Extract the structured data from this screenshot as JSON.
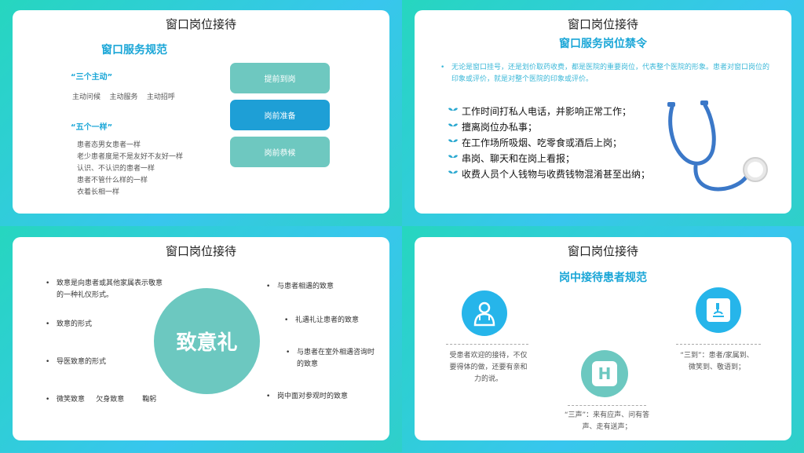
{
  "slide1": {
    "title": "窗口岗位接待",
    "subtitle": "窗口服务规范",
    "heading1": "“三个主动”",
    "line1": "主动问候    主动服务    主动招呼",
    "heading2": "“五个一样”",
    "five_lines": [
      "患者态男女患者一样",
      "老少患者度是不是友好不友好一样",
      "认识、不认识的患者一样",
      "患者不管什么样的一样",
      "衣着长相一样"
    ],
    "buttons": [
      "提前到岗",
      "岗前准备",
      "岗前恭候"
    ]
  },
  "slide2": {
    "title": "窗口岗位接待",
    "subtitle": "窗口服务岗位禁令",
    "intro": "无论是窗口挂号，还是划价取药收费，都是医院的重要岗位，代表整个医院的形象。患者对窗口岗位的印象或评价，就是对整个医院的印象或评价。",
    "rules": [
      "工作时间打私人电话，并影响正常工作；",
      "擅离岗位办私事；",
      "在工作场所吸烟、吃零食或酒后上岗；",
      "串岗、聊天和在岗上看报；",
      "收费人员个人钱物与收费钱物混淆甚至出纳；"
    ]
  },
  "slide3": {
    "title": "窗口岗位接待",
    "center": "致意礼",
    "left": [
      "致意是向患者或其他家属表示敬意的一种礼仪形式。",
      "致意的形式",
      "导医致意的形式",
      "微笑致意     欠身致意        鞠躬"
    ],
    "right": [
      "与患者相遇的致意",
      "礼遇礼让患者的致意",
      "与患者在室外相遇咨询时的致意",
      "岗中面对参观时的致意"
    ]
  },
  "slide4": {
    "title": "窗口岗位接待",
    "subtitle": "岗中接待患者规范",
    "left_text": "受患者欢迎的接待，不仅要得体的做，还要有亲和力的说。",
    "mid_text": "“三声”：来有应声、问有答声、走有送声；",
    "right_text": "“三到”：患者/家属到、微笑到、敬语到；",
    "h_letter": "H"
  },
  "colors": {
    "accent": "#1aa6d7",
    "teal_button": "#6ec8c0",
    "blue_button": "#1e9fd6",
    "circle": "#6cc8c0"
  }
}
